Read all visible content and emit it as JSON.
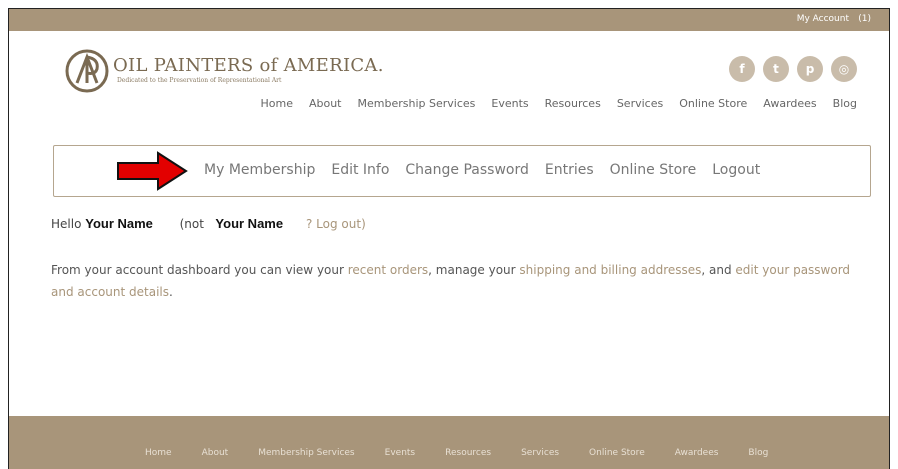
{
  "topbar": {
    "account_label": "My Account",
    "cart_count": "(1)"
  },
  "logo": {
    "name": "OIL PAINTERS of AMERICA.",
    "tagline": "Dedicated to the Preservation of Representational Art"
  },
  "social": {
    "facebook": "f",
    "twitter": "t",
    "pinterest": "p",
    "instagram": "◎"
  },
  "main_nav": [
    "Home",
    "About",
    "Membership Services",
    "Events",
    "Resources",
    "Services",
    "Online Store",
    "Awardees",
    "Blog"
  ],
  "account_nav": [
    "My Membership",
    "Edit Info",
    "Change Password",
    "Entries",
    "Online Store",
    "Logout"
  ],
  "hello": {
    "prefix": "Hello",
    "name": "Your Name",
    "not_prefix": "(not",
    "not_name": "Your Name",
    "logout_link": "? Log out)"
  },
  "dashboard": {
    "intro": "From your account dashboard you can view your ",
    "recent_orders": "recent orders",
    "mid1": ", manage your ",
    "addresses": "shipping and billing addresses",
    "mid2": ", and ",
    "edit_details": "edit your password and account details",
    "end": "."
  },
  "footer_nav": [
    "Home",
    "About",
    "Membership Services",
    "Events",
    "Resources",
    "Services",
    "Online Store",
    "Awardees",
    "Blog"
  ],
  "colors": {
    "brand": "#a8957a",
    "arrow": "#e30000"
  }
}
